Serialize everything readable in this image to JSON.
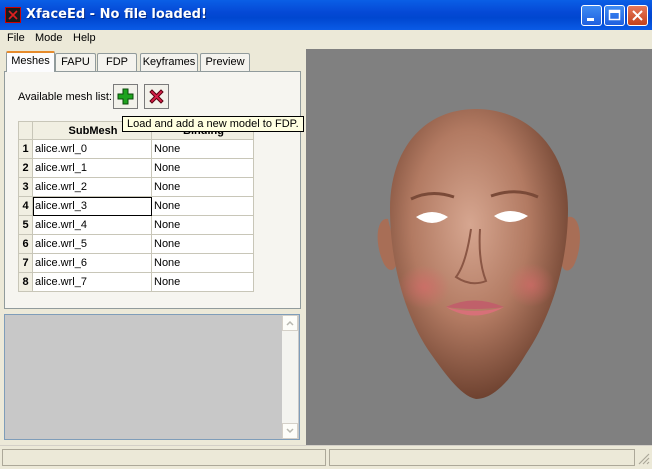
{
  "window": {
    "title": "XfaceEd - No file loaded!"
  },
  "menu": [
    "File",
    "Mode",
    "Help"
  ],
  "tabs": [
    "Meshes",
    "FAPU",
    "FDP",
    "Keyframes",
    "Preview"
  ],
  "meshes": {
    "available_label": "Available mesh list:",
    "add_icon": "green-plus-icon",
    "remove_icon": "red-x-icon",
    "tooltip": "Load and add a new model to FDP.",
    "columns": [
      "SubMesh",
      "Binding"
    ],
    "rows": [
      {
        "num": "1",
        "submesh": "alice.wrl_0",
        "binding": "None"
      },
      {
        "num": "2",
        "submesh": "alice.wrl_1",
        "binding": "None"
      },
      {
        "num": "3",
        "submesh": "alice.wrl_2",
        "binding": "None"
      },
      {
        "num": "4",
        "submesh": "alice.wrl_3",
        "binding": "None"
      },
      {
        "num": "5",
        "submesh": "alice.wrl_4",
        "binding": "None"
      },
      {
        "num": "6",
        "submesh": "alice.wrl_5",
        "binding": "None"
      },
      {
        "num": "7",
        "submesh": "alice.wrl_6",
        "binding": "None"
      },
      {
        "num": "8",
        "submesh": "alice.wrl_7",
        "binding": "None"
      }
    ]
  },
  "colors": {
    "titlebar": "#0549d6",
    "viewport_bg": "#808080",
    "active_tab": "#e68b2c",
    "tooltip_bg": "#ffffe1"
  }
}
